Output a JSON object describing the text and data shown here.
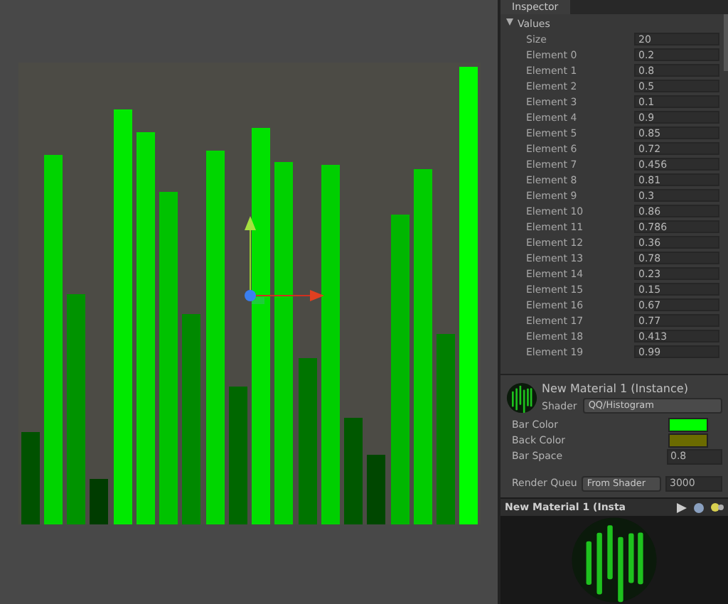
{
  "inspector": {
    "title": "Inspector",
    "section": {
      "label": "Values",
      "expanded": true
    },
    "size": {
      "label": "Size",
      "value": "20"
    },
    "elements": [
      {
        "label": "Element 0",
        "value": "0.2"
      },
      {
        "label": "Element 1",
        "value": "0.8"
      },
      {
        "label": "Element 2",
        "value": "0.5"
      },
      {
        "label": "Element 3",
        "value": "0.1"
      },
      {
        "label": "Element 4",
        "value": "0.9"
      },
      {
        "label": "Element 5",
        "value": "0.85"
      },
      {
        "label": "Element 6",
        "value": "0.72"
      },
      {
        "label": "Element 7",
        "value": "0.456"
      },
      {
        "label": "Element 8",
        "value": "0.81"
      },
      {
        "label": "Element 9",
        "value": "0.3"
      },
      {
        "label": "Element 10",
        "value": "0.86"
      },
      {
        "label": "Element 11",
        "value": "0.786"
      },
      {
        "label": "Element 12",
        "value": "0.36"
      },
      {
        "label": "Element 13",
        "value": "0.78"
      },
      {
        "label": "Element 14",
        "value": "0.23"
      },
      {
        "label": "Element 15",
        "value": "0.15"
      },
      {
        "label": "Element 16",
        "value": "0.67"
      },
      {
        "label": "Element 17",
        "value": "0.77"
      },
      {
        "label": "Element 18",
        "value": "0.413"
      },
      {
        "label": "Element 19",
        "value": "0.99"
      }
    ]
  },
  "material": {
    "name": "New Material 1 (Instance)",
    "shader_label": "Shader",
    "shader": "QQ/Histogram",
    "properties": [
      {
        "kind": "color",
        "label": "Bar Color",
        "color": "#00ff00"
      },
      {
        "kind": "color",
        "label": "Back Color",
        "color": "#6b6b00"
      },
      {
        "kind": "number",
        "label": "Bar Space",
        "value": "0.8"
      }
    ],
    "render_queue": {
      "label": "Render Queu",
      "mode": "From Shader",
      "value": "3000"
    }
  },
  "preview": {
    "title": "New Material 1 (Insta"
  }
}
